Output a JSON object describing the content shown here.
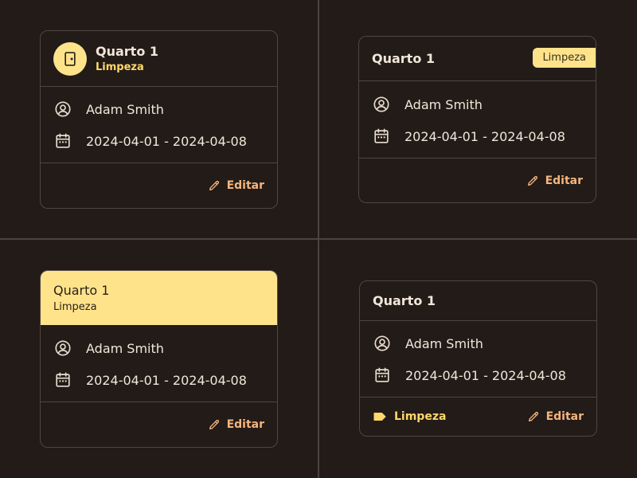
{
  "colors": {
    "background": "#221b17",
    "accent_yellow": "#ffe38a",
    "status_yellow": "#ffd86b",
    "edit_orange": "#f5b57f",
    "border": "#4e4641"
  },
  "cards": [
    {
      "title": "Quarto 1",
      "status": "Limpeza",
      "guest": "Adam Smith",
      "dates": "2024-04-01 - 2024-04-08",
      "edit_label": "Editar",
      "avatar_icon": "door-icon"
    },
    {
      "title": "Quarto 1",
      "status": "Limpeza",
      "guest": "Adam Smith",
      "dates": "2024-04-01 - 2024-04-08",
      "edit_label": "Editar"
    },
    {
      "title": "Quarto 1",
      "status": "Limpeza",
      "guest": "Adam Smith",
      "dates": "2024-04-01 - 2024-04-08",
      "edit_label": "Editar"
    },
    {
      "title": "Quarto 1",
      "status": "Limpeza",
      "guest": "Adam Smith",
      "dates": "2024-04-01 - 2024-04-08",
      "edit_label": "Editar",
      "tag_icon": "label-icon"
    }
  ]
}
